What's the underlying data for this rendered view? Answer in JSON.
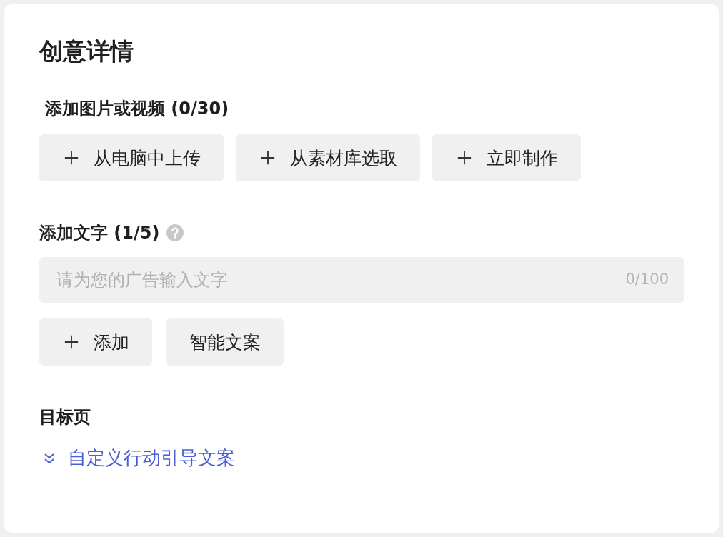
{
  "title": "创意详情",
  "media": {
    "label": "添加图片或视频",
    "count": "(0/30)",
    "buttons": [
      {
        "kind": "add",
        "label": "从电脑中上传"
      },
      {
        "kind": "add",
        "label": "从素材库选取"
      },
      {
        "kind": "add",
        "label": "立即制作"
      }
    ]
  },
  "text": {
    "label": "添加文字",
    "count": "(1/5)",
    "placeholder": "请为您的广告输入文字",
    "counter": "0/100",
    "buttons": [
      {
        "kind": "add",
        "label": "添加"
      },
      {
        "kind": "plain",
        "label": "智能文案"
      }
    ]
  },
  "landing": {
    "label": "目标页",
    "link": {
      "label": "自定义行动引导文案",
      "expanded": false
    }
  }
}
